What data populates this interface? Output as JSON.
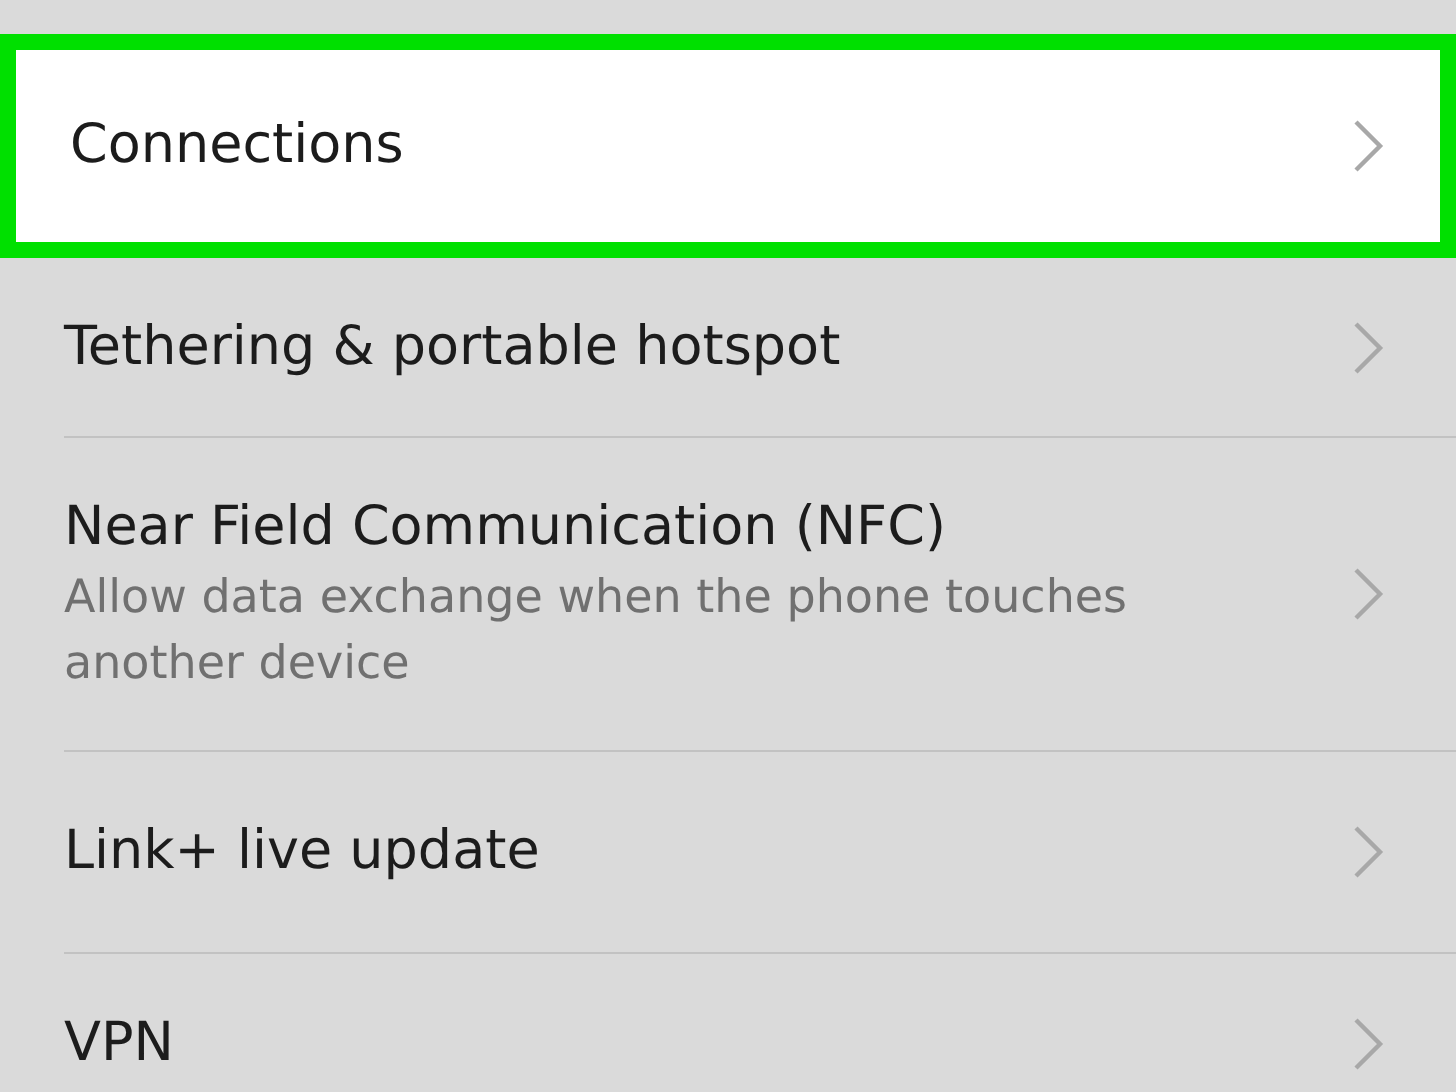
{
  "settings_items": [
    {
      "title": "Connections",
      "highlighted": true
    },
    {
      "title": "Tethering & portable hotspot",
      "highlighted": false
    },
    {
      "title": "Near Field Communication (NFC)",
      "subtitle": "Allow data exchange when the phone touches another device",
      "highlighted": false
    },
    {
      "title": "Link+ live update",
      "highlighted": false
    },
    {
      "title": "VPN",
      "highlighted": false
    }
  ]
}
